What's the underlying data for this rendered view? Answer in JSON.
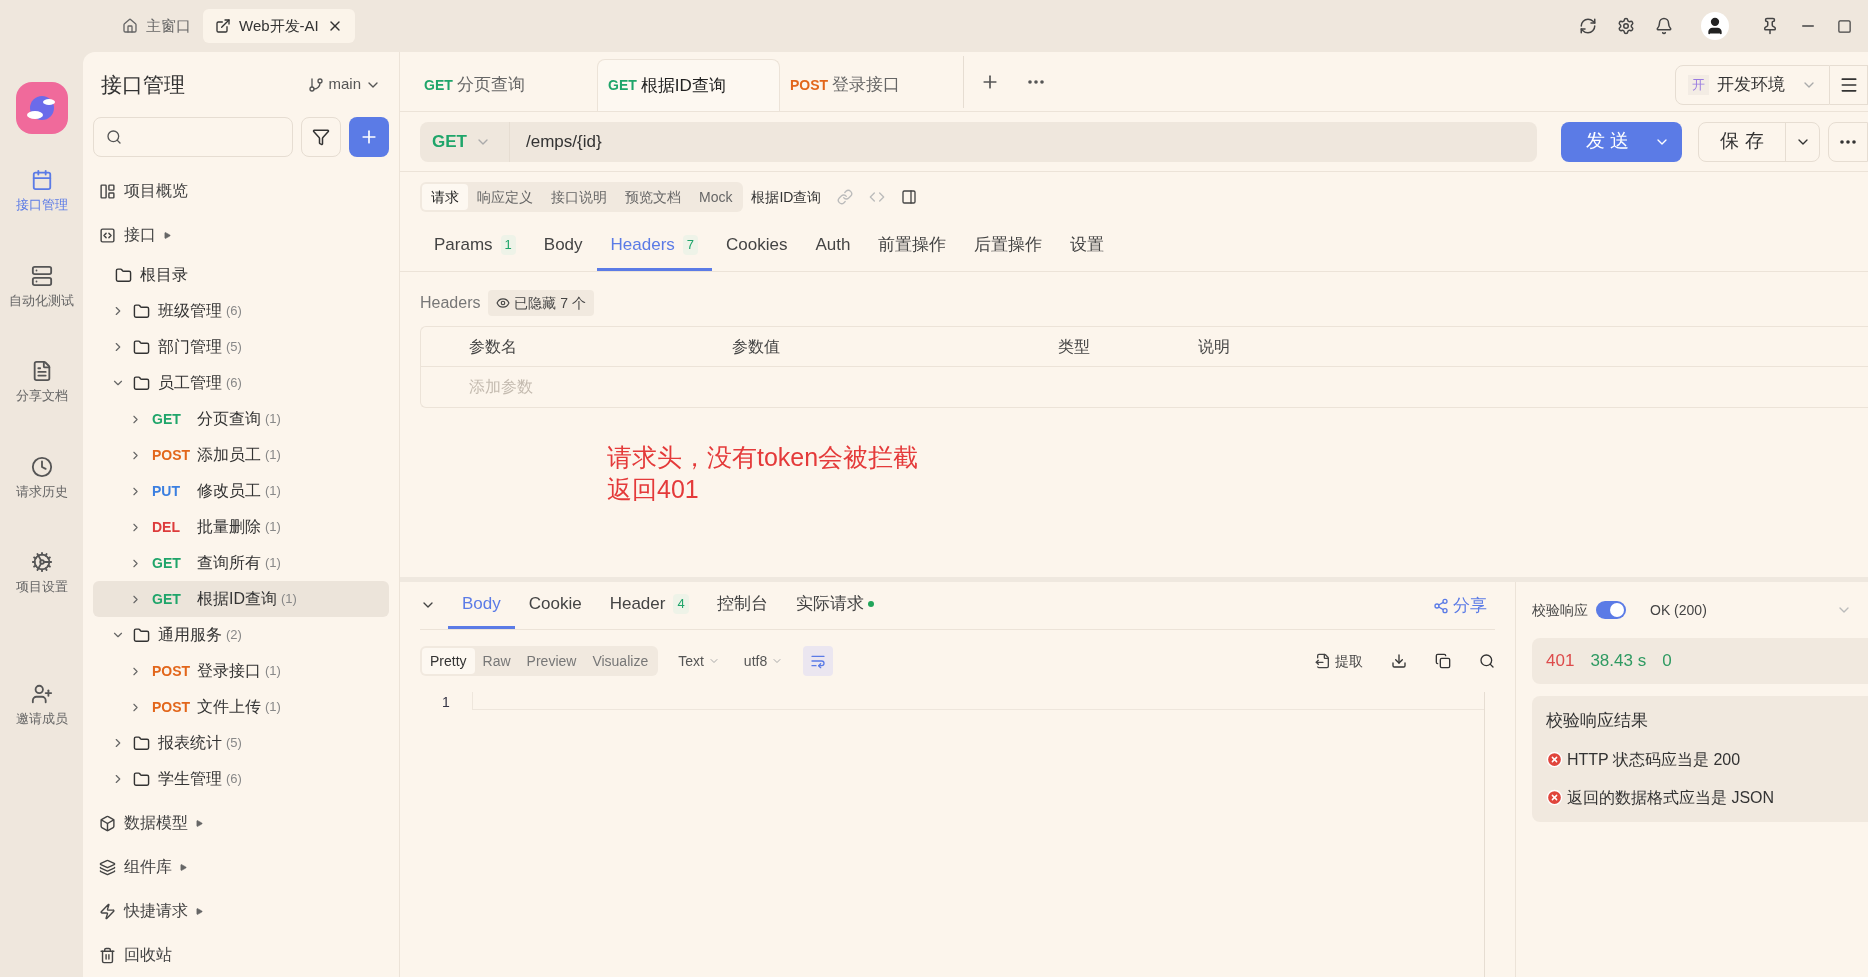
{
  "titlebar": {
    "tabs": [
      {
        "label": "主窗口",
        "selected": false,
        "kind": "home"
      },
      {
        "label": "Web开发-AI",
        "selected": true,
        "kind": "project"
      }
    ]
  },
  "rail": [
    {
      "label": "接口管理",
      "selected": true,
      "kind": "api"
    },
    {
      "label": "自动化测试",
      "selected": false,
      "kind": "auto"
    },
    {
      "label": "分享文档",
      "selected": false,
      "kind": "share"
    },
    {
      "label": "请求历史",
      "selected": false,
      "kind": "history"
    },
    {
      "label": "项目设置",
      "selected": false,
      "kind": "settings"
    },
    {
      "label": "邀请成员",
      "selected": false,
      "kind": "invite"
    }
  ],
  "sidebar": {
    "title": "接口管理",
    "branch": "main",
    "items_top": [
      {
        "label": "项目概览",
        "kind": "overview",
        "expandable": false
      },
      {
        "label": "接口",
        "kind": "api",
        "expandable": true
      }
    ],
    "tree": [
      {
        "label": "根目录",
        "children": [
          {
            "label": "班级管理",
            "count": "(6)",
            "expanded": false
          },
          {
            "label": "部门管理",
            "count": "(5)",
            "expanded": false
          },
          {
            "label": "员工管理",
            "count": "(6)",
            "expanded": true,
            "children": [
              {
                "method": "GET",
                "color": "#1fa56a",
                "label": "分页查询",
                "count": "(1)",
                "selected": false
              },
              {
                "method": "POST",
                "color": "#e2661b",
                "label": "添加员工",
                "count": "(1)",
                "selected": false
              },
              {
                "method": "PUT",
                "color": "#3b7fe0",
                "label": "修改员工",
                "count": "(1)",
                "selected": false
              },
              {
                "method": "DEL",
                "color": "#dd3b3b",
                "label": "批量删除",
                "count": "(1)",
                "selected": false
              },
              {
                "method": "GET",
                "color": "#1fa56a",
                "label": "查询所有",
                "count": "(1)",
                "selected": false
              },
              {
                "method": "GET",
                "color": "#1fa56a",
                "label": "根据ID查询",
                "count": "(1)",
                "selected": true
              }
            ]
          },
          {
            "label": "通用服务",
            "count": "(2)",
            "expanded": true,
            "children": [
              {
                "method": "POST",
                "color": "#e2661b",
                "label": "登录接口",
                "count": "(1)",
                "selected": false
              },
              {
                "method": "POST",
                "color": "#e2661b",
                "label": "文件上传",
                "count": "(1)",
                "selected": false
              }
            ]
          },
          {
            "label": "报表统计",
            "count": "(5)",
            "expanded": false
          },
          {
            "label": "学生管理",
            "count": "(6)",
            "expanded": false
          }
        ]
      }
    ],
    "items_bottom": [
      {
        "label": "数据模型",
        "kind": "model",
        "expandable": true
      },
      {
        "label": "组件库",
        "kind": "lib",
        "expandable": true
      },
      {
        "label": "快捷请求",
        "kind": "quick",
        "expandable": true
      },
      {
        "label": "回收站",
        "kind": "trash",
        "expandable": false
      }
    ]
  },
  "request_tabs": [
    {
      "method": "GET",
      "color": "#1fa56a",
      "label": "分页查询",
      "selected": false
    },
    {
      "method": "GET",
      "color": "#1fa56a",
      "label": "根据ID查询",
      "selected": true
    },
    {
      "method": "POST",
      "color": "#e2661b",
      "label": "登录接口",
      "selected": false
    }
  ],
  "environment": {
    "badge": "开",
    "label": "开发环境"
  },
  "url_bar": {
    "method": "GET",
    "color": "#1fa56a",
    "path": "/emps/{id}"
  },
  "send_button": "发 送",
  "save_button": "保 存",
  "view_tabs": [
    {
      "label": "请求",
      "selected": true
    },
    {
      "label": "响应定义",
      "selected": false
    },
    {
      "label": "接口说明",
      "selected": false
    },
    {
      "label": "预览文档",
      "selected": false
    },
    {
      "label": "Mock",
      "selected": false
    }
  ],
  "endpoint_name": "根据ID查询",
  "param_tabs": [
    {
      "label": "Params",
      "count": "1",
      "selected": false
    },
    {
      "label": "Body",
      "selected": false
    },
    {
      "label": "Headers",
      "count": "7",
      "selected": true
    },
    {
      "label": "Cookies",
      "selected": false
    },
    {
      "label": "Auth",
      "selected": false
    },
    {
      "label": "前置操作",
      "selected": false
    },
    {
      "label": "后置操作",
      "selected": false
    },
    {
      "label": "设置",
      "selected": false
    }
  ],
  "headers": {
    "label": "Headers",
    "hidden_badge": "已隐藏 7 个",
    "columns": [
      "参数名",
      "参数值",
      "类型",
      "说明"
    ],
    "placeholder": "添加参数"
  },
  "annotation": {
    "lines": [
      "请求头，没有token会被拦截",
      "返回401"
    ]
  },
  "response": {
    "tabs": [
      {
        "label": "Body",
        "selected": true,
        "status_dot": false
      },
      {
        "label": "Cookie",
        "selected": false,
        "status_dot": false
      },
      {
        "label": "Header",
        "count": "4",
        "selected": false,
        "status_dot": false
      },
      {
        "label": "控制台",
        "selected": false,
        "status_dot": false
      },
      {
        "label": "实际请求",
        "selected": false,
        "status_dot": true
      }
    ],
    "share": "分享",
    "formats": [
      {
        "label": "Pretty",
        "selected": true
      },
      {
        "label": "Raw",
        "selected": false
      },
      {
        "label": "Preview",
        "selected": false
      },
      {
        "label": "Visualize",
        "selected": false
      }
    ],
    "type_select": "Text",
    "encoding_select": "utf8",
    "wrap_on": true,
    "extract": "提取",
    "line_numbers": [
      "1"
    ]
  },
  "validation": {
    "label": "校验响应",
    "on": true,
    "expected": "OK (200)",
    "status": "401",
    "time": "38.43 s",
    "size": "0",
    "result_title": "校验响应结果",
    "results": [
      "HTTP 状态码应当是 200",
      "返回的数据格式应当是 JSON"
    ]
  }
}
